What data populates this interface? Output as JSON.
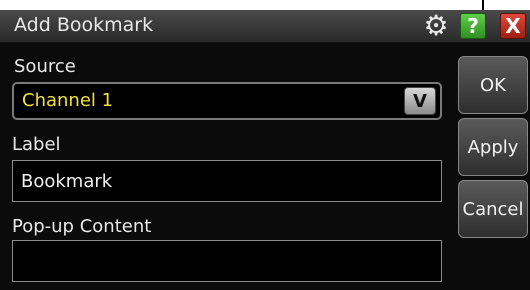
{
  "dialog": {
    "title": "Add Bookmark",
    "icons": {
      "settings": "gear-icon",
      "help": "help-icon",
      "close": "close-icon"
    },
    "help_glyph": "?",
    "close_glyph": "X"
  },
  "source": {
    "label": "Source",
    "value": "Channel 1",
    "dropdown_glyph": "V"
  },
  "label_field": {
    "label": "Label",
    "value": "Bookmark"
  },
  "popup_field": {
    "label": "Pop-up Content",
    "value": ""
  },
  "buttons": {
    "ok": "OK",
    "apply": "Apply",
    "cancel": "Cancel"
  },
  "colors": {
    "value_accent": "#f0e040",
    "help_green": "#3fa52e",
    "close_red": "#c0291c"
  }
}
